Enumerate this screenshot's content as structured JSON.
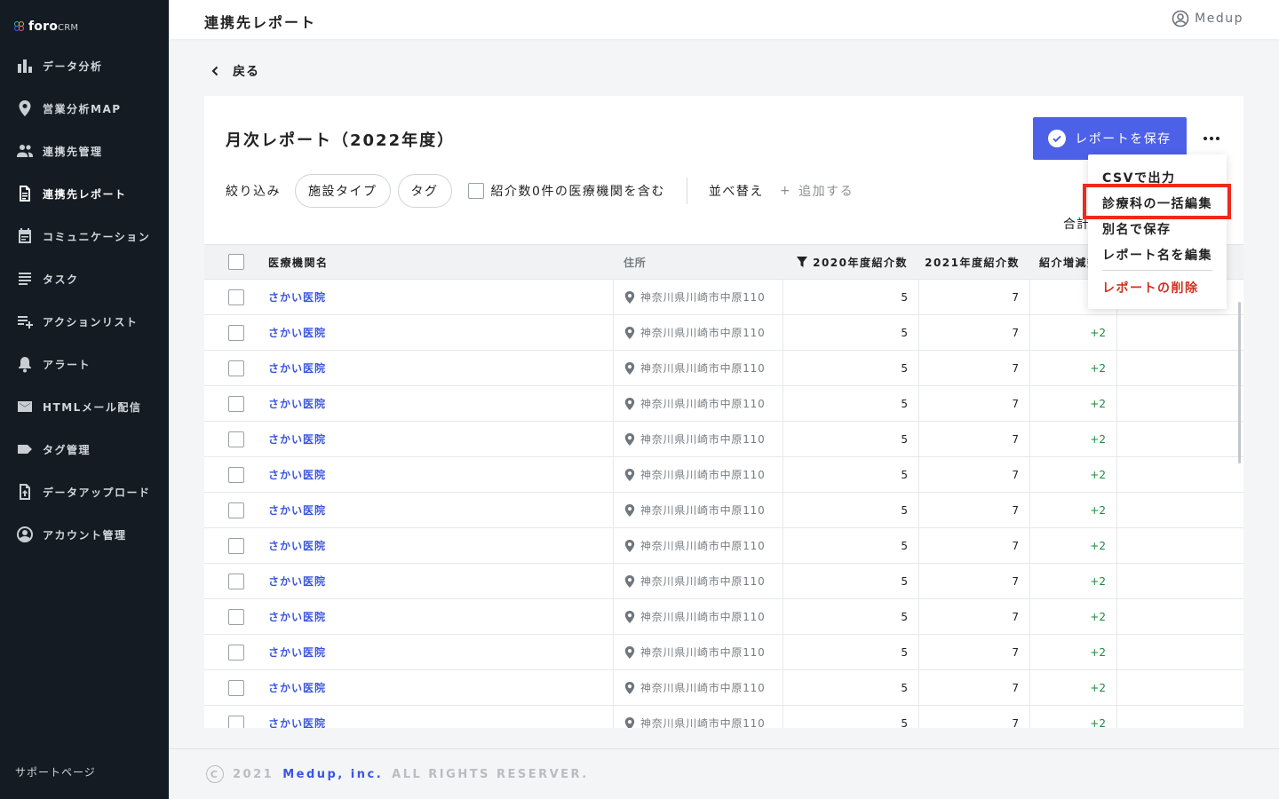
{
  "brand": {
    "name": "foro",
    "suffix": "CRM"
  },
  "sidebar": {
    "items": [
      {
        "label": "データ分析",
        "icon": "bar-chart-icon"
      },
      {
        "label": "営業分析MAP",
        "icon": "map-pin-icon"
      },
      {
        "label": "連携先管理",
        "icon": "people-icon"
      },
      {
        "label": "連携先レポート",
        "icon": "document-icon",
        "active": true
      },
      {
        "label": "コミュニケーション",
        "icon": "calendar-icon"
      },
      {
        "label": "タスク",
        "icon": "list-icon"
      },
      {
        "label": "アクションリスト",
        "icon": "playlist-add-icon"
      },
      {
        "label": "アラート",
        "icon": "bell-icon"
      },
      {
        "label": "HTMLメール配信",
        "icon": "mail-icon"
      },
      {
        "label": "タグ管理",
        "icon": "tag-icon"
      },
      {
        "label": "データアップロード",
        "icon": "upload-file-icon"
      },
      {
        "label": "アカウント管理",
        "icon": "account-icon"
      }
    ],
    "support": "サポートページ"
  },
  "header": {
    "title": "連携先レポート",
    "user": "Medup"
  },
  "back_label": "戻る",
  "report": {
    "title": "月次レポート（2022年度）",
    "save_label": "レポートを保存",
    "filter_label": "絞り込み",
    "chips": [
      "施設タイプ",
      "タグ"
    ],
    "include_zero_label": "紹介数0件の医療機関を含む",
    "sort_label": "並べ替え",
    "add_label": "追加する",
    "total_label": "合計"
  },
  "menu": {
    "items": [
      "CSVで出力",
      "診療科の一括編集",
      "別名で保存",
      "レポート名を編集"
    ],
    "danger": "レポートの削除",
    "highlighted": "診療科の一括編集",
    "highlight_color": "#ee2a1c"
  },
  "table": {
    "columns": {
      "name": "医療機関名",
      "address": "住所",
      "y2020": "2020年度紹介数",
      "y2021": "2021年度紹介数",
      "diff": "紹介増減数"
    },
    "rows": [
      {
        "name": "さかい医院",
        "address": "神奈川県川崎市中原110",
        "y2020": "5",
        "y2021": "7",
        "diff": ""
      },
      {
        "name": "さかい医院",
        "address": "神奈川県川崎市中原110",
        "y2020": "5",
        "y2021": "7",
        "diff": "+2"
      },
      {
        "name": "さかい医院",
        "address": "神奈川県川崎市中原110",
        "y2020": "5",
        "y2021": "7",
        "diff": "+2"
      },
      {
        "name": "さかい医院",
        "address": "神奈川県川崎市中原110",
        "y2020": "5",
        "y2021": "7",
        "diff": "+2"
      },
      {
        "name": "さかい医院",
        "address": "神奈川県川崎市中原110",
        "y2020": "5",
        "y2021": "7",
        "diff": "+2"
      },
      {
        "name": "さかい医院",
        "address": "神奈川県川崎市中原110",
        "y2020": "5",
        "y2021": "7",
        "diff": "+2"
      },
      {
        "name": "さかい医院",
        "address": "神奈川県川崎市中原110",
        "y2020": "5",
        "y2021": "7",
        "diff": "+2"
      },
      {
        "name": "さかい医院",
        "address": "神奈川県川崎市中原110",
        "y2020": "5",
        "y2021": "7",
        "diff": "+2"
      },
      {
        "name": "さかい医院",
        "address": "神奈川県川崎市中原110",
        "y2020": "5",
        "y2021": "7",
        "diff": "+2"
      },
      {
        "name": "さかい医院",
        "address": "神奈川県川崎市中原110",
        "y2020": "5",
        "y2021": "7",
        "diff": "+2"
      },
      {
        "name": "さかい医院",
        "address": "神奈川県川崎市中原110",
        "y2020": "5",
        "y2021": "7",
        "diff": "+2"
      },
      {
        "name": "さかい医院",
        "address": "神奈川県川崎市中原110",
        "y2020": "5",
        "y2021": "7",
        "diff": "+2"
      },
      {
        "name": "さかい医院",
        "address": "神奈川県川崎市中原110",
        "y2020": "5",
        "y2021": "7",
        "diff": "+2"
      }
    ]
  },
  "footer": {
    "year": "2021",
    "company": "Medup, inc.",
    "rights": "ALL RIGHTS RESERVER."
  },
  "colors": {
    "accent": "#4d60e8",
    "link": "#3b55e0",
    "positive": "#1a8a3a",
    "danger": "#d0311f",
    "sidebar_bg": "#141b22"
  }
}
